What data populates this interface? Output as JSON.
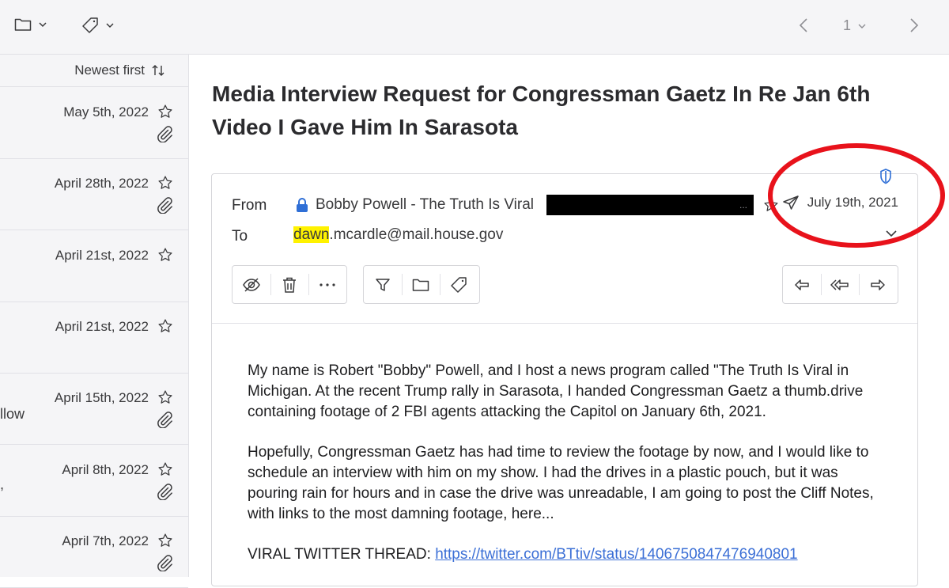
{
  "toolbar": {
    "folder_icon": "folder-icon",
    "tag_icon": "tag-icon",
    "page_number": "1"
  },
  "list": {
    "sort_label": "Newest first",
    "items": [
      {
        "date": "May 5th, 2022",
        "attachment": true
      },
      {
        "date": "April 28th, 2022",
        "attachment": true
      },
      {
        "date": "April 21st, 2022",
        "attachment": false
      },
      {
        "date": "April 21st, 2022",
        "attachment": false
      },
      {
        "date": "April 15th, 2022",
        "attachment": true,
        "fragment": "llow"
      },
      {
        "date": "April 8th, 2022",
        "attachment": true,
        "fragment": ","
      },
      {
        "date": "April 7th, 2022",
        "attachment": true
      }
    ]
  },
  "message": {
    "subject": "Media Interview Request for Congressman Gaetz In Re Jan 6th Video I Gave Him In Sarasota",
    "from_label": "From",
    "to_label": "To",
    "sender": "Bobby Powell - The Truth Is Viral",
    "redaction_trailing": "...",
    "to_highlight": "dawn",
    "to_rest": ".mcardle@mail.house.gov",
    "date": "July 19th, 2021",
    "body": {
      "p1": "My name is Robert \"Bobby\" Powell, and I host a news program called \"The Truth Is Viral in Michigan. At the recent Trump rally in Sarasota, I handed Congressman Gaetz a thumb.drive containing footage of 2 FBI agents attacking the Capitol on January 6th, 2021.",
      "p2": "Hopefully, Congressman Gaetz has had time to review the footage by now, and I would like to schedule an interview with him on my show. I had the drives in a plastic pouch, but it was pouring rain for hours and in case the drive was unreadable, I am going to post the Cliff Notes, with links to the most damning footage, here...",
      "p3_label": "VIRAL TWITTER THREAD: ",
      "p3_link": "https://twitter.com/BTtiv/status/1406750847476940801"
    }
  },
  "colors": {
    "annotation": "#e8121b",
    "lock": "#2f6fd6",
    "link": "#3b6fd6",
    "highlight": "#fff200"
  }
}
